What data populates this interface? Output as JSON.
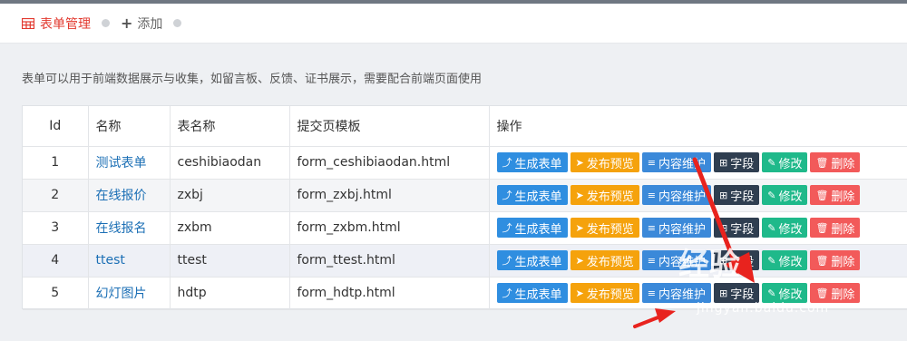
{
  "tabs": {
    "active_label": "表单管理",
    "add_label": "添加"
  },
  "description": "表单可以用于前端数据展示与收集，如留言板、反馈、证书展示，需要配合前端页面使用",
  "table": {
    "headers": [
      "Id",
      "名称",
      "表名称",
      "提交页模板",
      "操作"
    ],
    "rows": [
      {
        "id": "1",
        "name": "测试表单",
        "table_name": "ceshibiaodan",
        "template": "form_ceshibiaodan.html"
      },
      {
        "id": "2",
        "name": "在线报价",
        "table_name": "zxbj",
        "template": "form_zxbj.html"
      },
      {
        "id": "3",
        "name": "在线报名",
        "table_name": "zxbm",
        "template": "form_zxbm.html"
      },
      {
        "id": "4",
        "name": "ttest",
        "table_name": "ttest",
        "template": "form_ttest.html"
      },
      {
        "id": "5",
        "name": "幻灯图片",
        "table_name": "hdtp",
        "template": "form_hdtp.html"
      }
    ],
    "actions": {
      "generate": "生成表单",
      "publish": "发布预览",
      "content": "内容维护",
      "field": "字段",
      "edit": "修改",
      "delete": "删除"
    }
  },
  "watermark": {
    "brand": "经验",
    "url": "jingyan.baidu.com"
  },
  "colors": {
    "active_tab": "#e2382e",
    "link": "#1b6fb5",
    "arrow": "#e8231e"
  }
}
